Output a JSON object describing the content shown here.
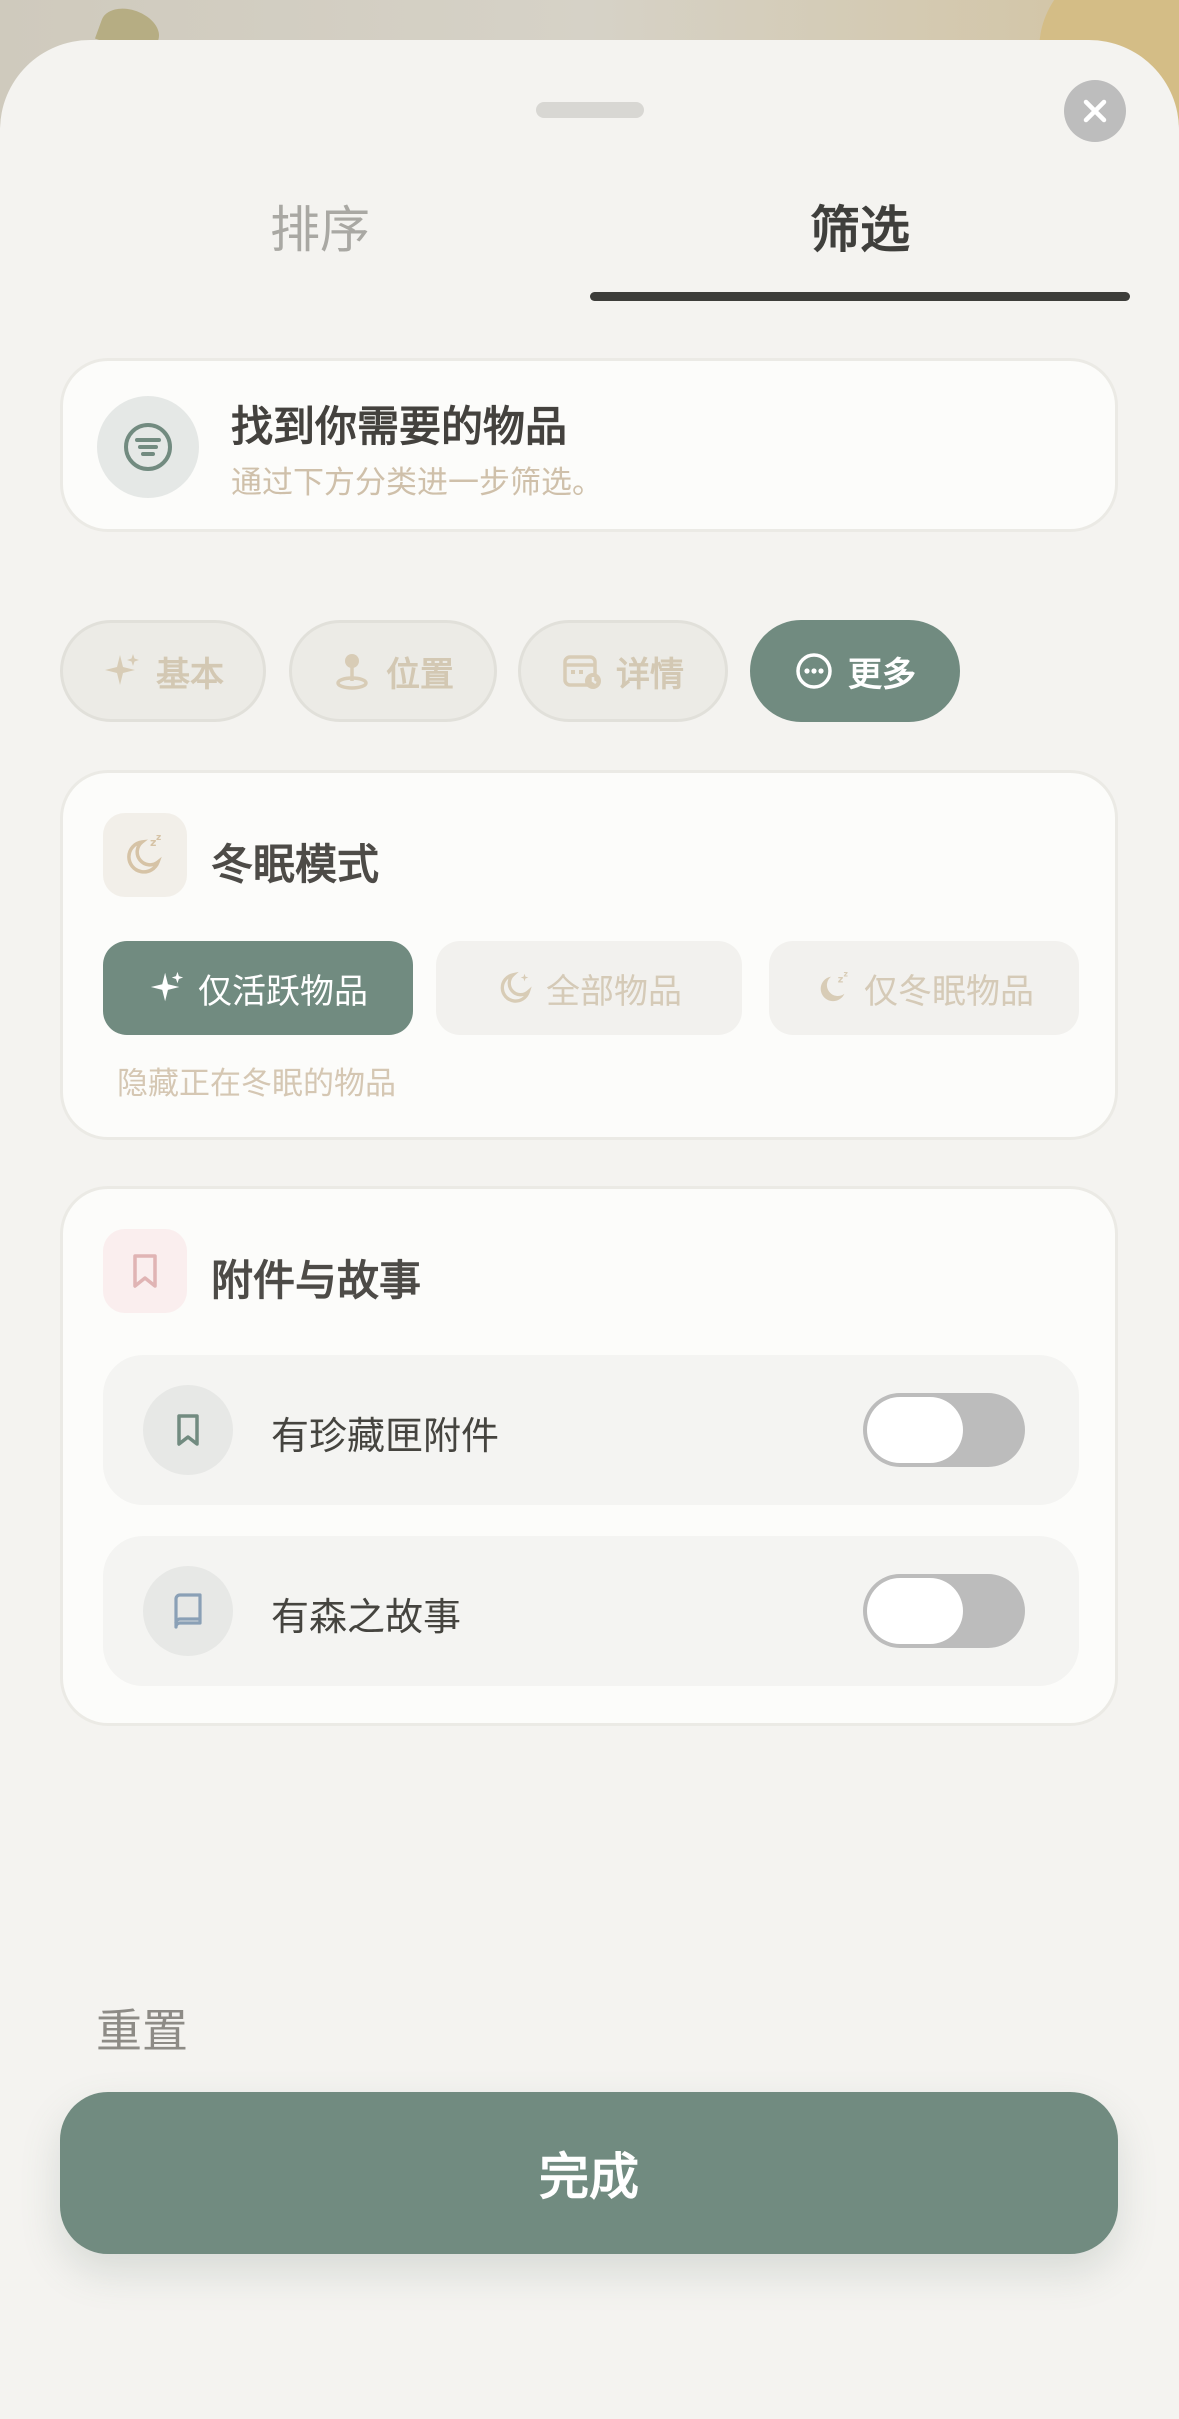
{
  "colors": {
    "accent": "#718b80",
    "sheet": "#f4f3f0",
    "card": "#fcfcfa",
    "muted_text": "#cfc0aa"
  },
  "tabs": [
    {
      "label": "排序",
      "active": false
    },
    {
      "label": "筛选",
      "active": true
    }
  ],
  "intro": {
    "icon": "filter-icon",
    "title": "找到你需要的物品",
    "subtitle": "通过下方分类进一步筛选。"
  },
  "categories": [
    {
      "label": "基本",
      "icon": "sparkle-icon",
      "active": false
    },
    {
      "label": "位置",
      "icon": "location-pin-icon",
      "active": false
    },
    {
      "label": "详情",
      "icon": "calendar-icon",
      "active": false
    },
    {
      "label": "更多",
      "icon": "more-dots-icon",
      "active": true
    }
  ],
  "hibernation": {
    "icon": "sleep-moon-icon",
    "title": "冬眠模式",
    "options": [
      {
        "label": "仅活跃物品",
        "icon": "sparkle-icon",
        "selected": true
      },
      {
        "label": "全部物品",
        "icon": "moon-icon",
        "selected": false
      },
      {
        "label": "仅冬眠物品",
        "icon": "sleep-moon-icon",
        "selected": false
      }
    ],
    "hint": "隐藏正在冬眠的物品"
  },
  "attachments": {
    "icon": "bookmark-icon",
    "title": "附件与故事",
    "rows": [
      {
        "label": "有珍藏匣附件",
        "icon": "bookmark-icon",
        "on": false
      },
      {
        "label": "有森之故事",
        "icon": "book-icon",
        "on": false
      }
    ]
  },
  "footer": {
    "reset_label": "重置",
    "done_label": "完成"
  }
}
